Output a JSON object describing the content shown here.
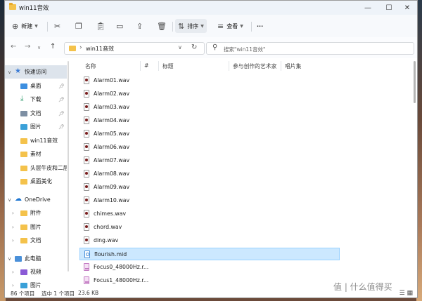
{
  "window": {
    "title": "win11音效"
  },
  "toolbar": {
    "new_label": "新建",
    "sort_label": "排序",
    "view_label": "查看",
    "more_label": "···"
  },
  "address": {
    "path": "win11音效"
  },
  "search": {
    "placeholder": "搜索\"win11音效\""
  },
  "sidebar": [
    {
      "label": "快速访问",
      "icon": "star-icon",
      "expanded": true
    },
    {
      "label": "桌面",
      "icon": "desktop-icon",
      "pinned": true
    },
    {
      "label": "下载",
      "icon": "download-icon",
      "pinned": true
    },
    {
      "label": "文档",
      "icon": "document-icon",
      "pinned": true
    },
    {
      "label": "图片",
      "icon": "picture-icon",
      "pinned": true
    },
    {
      "label": "win11音效",
      "icon": "folder-icon"
    },
    {
      "label": "素材",
      "icon": "folder-icon"
    },
    {
      "label": "头层牛皮和二层",
      "icon": "folder-icon"
    },
    {
      "label": "桌面美化",
      "icon": "folder-icon"
    },
    {
      "label": "OneDrive",
      "icon": "cloud-icon",
      "expanded": true
    },
    {
      "label": "附件",
      "icon": "folder-icon"
    },
    {
      "label": "图片",
      "icon": "folder-icon"
    },
    {
      "label": "文档",
      "icon": "folder-icon"
    },
    {
      "label": "此电脑",
      "icon": "pc-icon",
      "expanded": true
    },
    {
      "label": "视频",
      "icon": "video-icon"
    },
    {
      "label": "图片",
      "icon": "picture-icon"
    }
  ],
  "columns": {
    "name": "名称",
    "number": "#",
    "title": "标题",
    "artists": "参与创作的艺术家",
    "album": "唱片集"
  },
  "files": [
    {
      "name": "Alarm01.wav",
      "type": "wav"
    },
    {
      "name": "Alarm02.wav",
      "type": "wav"
    },
    {
      "name": "Alarm03.wav",
      "type": "wav"
    },
    {
      "name": "Alarm04.wav",
      "type": "wav"
    },
    {
      "name": "Alarm05.wav",
      "type": "wav"
    },
    {
      "name": "Alarm06.wav",
      "type": "wav"
    },
    {
      "name": "Alarm07.wav",
      "type": "wav"
    },
    {
      "name": "Alarm08.wav",
      "type": "wav"
    },
    {
      "name": "Alarm09.wav",
      "type": "wav"
    },
    {
      "name": "Alarm10.wav",
      "type": "wav"
    },
    {
      "name": "chimes.wav",
      "type": "wav"
    },
    {
      "name": "chord.wav",
      "type": "wav"
    },
    {
      "name": "ding.wav",
      "type": "wav"
    },
    {
      "name": "flourish.mid",
      "type": "mid",
      "selected": true
    },
    {
      "name": "Focus0_48000Hz.r...",
      "type": "img"
    },
    {
      "name": "Focus1_48000Hz.r...",
      "type": "img"
    }
  ],
  "status": {
    "count": "86 个项目",
    "selected": "选中 1 个项目",
    "size": "23.6 KB"
  },
  "watermark": "值 | 什么值得买"
}
